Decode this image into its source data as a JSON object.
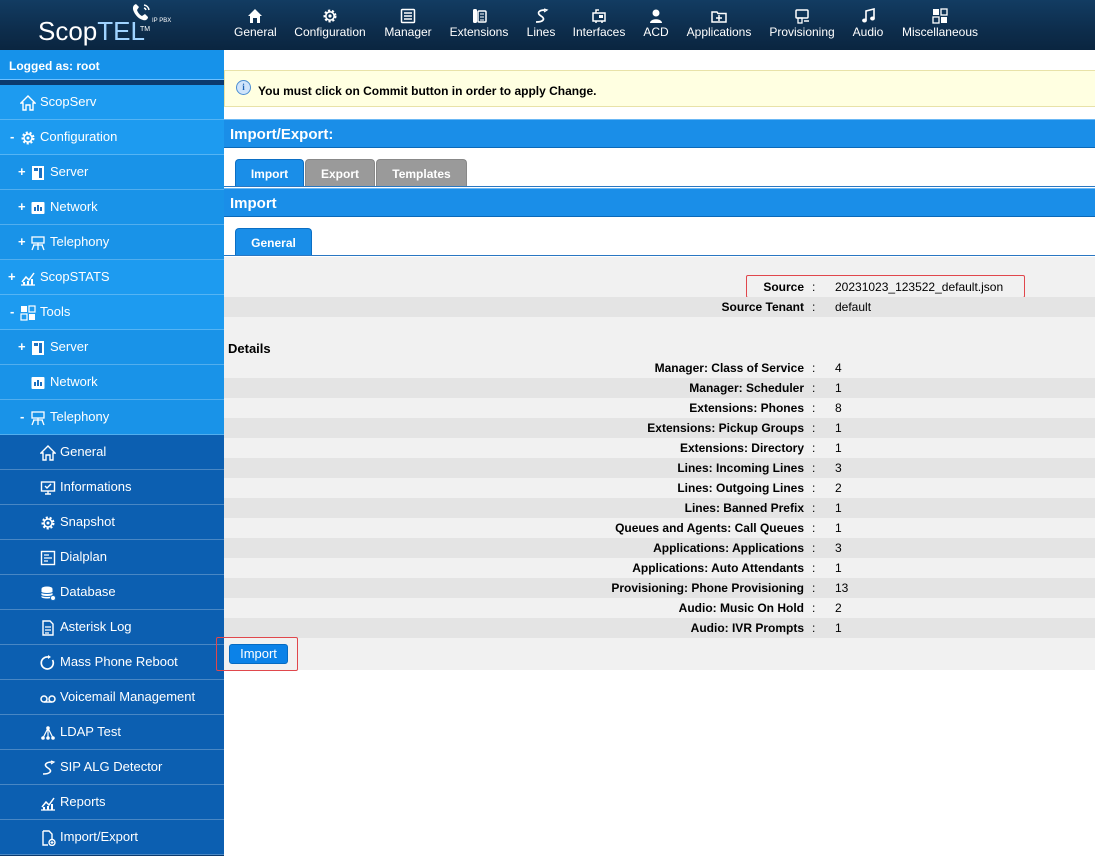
{
  "app": {
    "logo_main": "Scop",
    "logo_accent": "TEL",
    "logo_sub": "IP PBX",
    "logo_tm": "TM"
  },
  "topnav": [
    {
      "label": "General",
      "icon": "home-icon"
    },
    {
      "label": "Configuration",
      "icon": "gear-icon"
    },
    {
      "label": "Manager",
      "icon": "list-icon"
    },
    {
      "label": "Extensions",
      "icon": "phone-icon"
    },
    {
      "label": "Lines",
      "icon": "lines-icon"
    },
    {
      "label": "Interfaces",
      "icon": "interfaces-icon"
    },
    {
      "label": "ACD",
      "icon": "agent-icon"
    },
    {
      "label": "Applications",
      "icon": "applications-icon"
    },
    {
      "label": "Provisioning",
      "icon": "provisioning-icon"
    },
    {
      "label": "Audio",
      "icon": "music-icon"
    },
    {
      "label": "Miscellaneous",
      "icon": "misc-icon"
    }
  ],
  "sidebar": {
    "logged": "Logged as: root",
    "items": [
      {
        "label": "ScopServ",
        "expander": "",
        "icon": "home-icon"
      },
      {
        "label": "Configuration",
        "expander": "-",
        "icon": "gear-icon"
      },
      {
        "label": "Server",
        "expander": "+",
        "icon": "server-icon"
      },
      {
        "label": "Network",
        "expander": "+",
        "icon": "network-icon"
      },
      {
        "label": "Telephony",
        "expander": "+",
        "icon": "telephony-icon"
      },
      {
        "label": "ScopSTATS",
        "expander": "+",
        "icon": "stats-icon"
      },
      {
        "label": "Tools",
        "expander": "-",
        "icon": "tools-icon"
      },
      {
        "label": "Server",
        "expander": "+",
        "icon": "server-icon"
      },
      {
        "label": "Network",
        "expander": "",
        "icon": "network-icon"
      },
      {
        "label": "Telephony",
        "expander": "-",
        "icon": "telephony-icon"
      },
      {
        "label": "General",
        "expander": "",
        "icon": "home-icon"
      },
      {
        "label": "Informations",
        "expander": "",
        "icon": "monitor-icon"
      },
      {
        "label": "Snapshot",
        "expander": "",
        "icon": "gear-icon"
      },
      {
        "label": "Dialplan",
        "expander": "",
        "icon": "dialplan-icon"
      },
      {
        "label": "Database",
        "expander": "",
        "icon": "database-icon"
      },
      {
        "label": "Asterisk Log",
        "expander": "",
        "icon": "document-icon"
      },
      {
        "label": "Mass Phone Reboot",
        "expander": "",
        "icon": "reboot-icon"
      },
      {
        "label": "Voicemail Management",
        "expander": "",
        "icon": "voicemail-icon"
      },
      {
        "label": "LDAP Test",
        "expander": "",
        "icon": "ldap-icon"
      },
      {
        "label": "SIP ALG Detector",
        "expander": "",
        "icon": "lines-icon"
      },
      {
        "label": "Reports",
        "expander": "",
        "icon": "stats-icon"
      },
      {
        "label": "Import/Export",
        "expander": "",
        "icon": "import-export-icon"
      }
    ]
  },
  "notice": {
    "icon": "i",
    "text": "You must click on Commit button in order to apply Change."
  },
  "section_title": "Import/Export:",
  "tabs": [
    {
      "label": "Import",
      "active": true
    },
    {
      "label": "Export",
      "active": false
    },
    {
      "label": "Templates",
      "active": false
    }
  ],
  "subsection_title": "Import",
  "subtabs": [
    {
      "label": "General",
      "active": true
    }
  ],
  "form": {
    "source_label": "Source",
    "source_value": "20231023_123522_default.json",
    "tenant_label": "Source Tenant",
    "tenant_value": "default",
    "details_heading": "Details",
    "separator": ":",
    "details": [
      {
        "label": "Manager: Class of Service",
        "value": "4"
      },
      {
        "label": "Manager: Scheduler",
        "value": "1"
      },
      {
        "label": "Extensions: Phones",
        "value": "8"
      },
      {
        "label": "Extensions: Pickup Groups",
        "value": "1"
      },
      {
        "label": "Extensions: Directory",
        "value": "1"
      },
      {
        "label": "Lines: Incoming Lines",
        "value": "3"
      },
      {
        "label": "Lines: Outgoing Lines",
        "value": "2"
      },
      {
        "label": "Lines: Banned Prefix",
        "value": "1"
      },
      {
        "label": "Queues and Agents: Call Queues",
        "value": "1"
      },
      {
        "label": "Applications: Applications",
        "value": "3"
      },
      {
        "label": "Applications: Auto Attendants",
        "value": "1"
      },
      {
        "label": "Provisioning: Phone Provisioning",
        "value": "13"
      },
      {
        "label": "Audio: Music On Hold",
        "value": "2"
      },
      {
        "label": "Audio: IVR Prompts",
        "value": "1"
      }
    ],
    "import_button": "Import"
  }
}
